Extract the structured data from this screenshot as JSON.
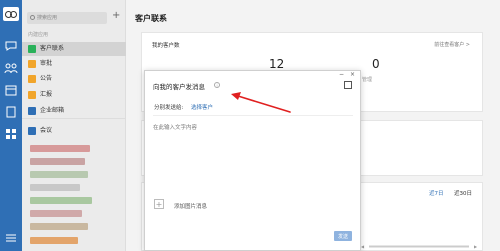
{
  "sidebar": {
    "search_placeholder": "搜索应用",
    "section_label": "内建应用",
    "items": [
      {
        "label": "客户联系",
        "color": "#2ab15a"
      },
      {
        "label": "审批",
        "color": "#f1a52b"
      },
      {
        "label": "公告",
        "color": "#f1a52b"
      },
      {
        "label": "汇报",
        "color": "#f1a52b"
      },
      {
        "label": "企业邮箱",
        "color": "#2f6fb5"
      },
      {
        "label": "会议",
        "color": "#2f6fb5"
      }
    ]
  },
  "main": {
    "title": "客户联系",
    "card": {
      "title": "我的客户数",
      "link": "前往查看客户 >",
      "num1": "12",
      "num2": "0",
      "sub2": "管理"
    },
    "range": {
      "r1": "近7日",
      "r2": "近30日"
    }
  },
  "dialog": {
    "title": "向我的客户发消息",
    "recv_label": "分别发送给:",
    "recv_link": "选择客户",
    "placeholder": "在此输入文字内容",
    "add_img": "添加图片消息",
    "send": "发送"
  },
  "colors": {
    "accent": "#2f6fb5",
    "arrow": "#e02020"
  }
}
